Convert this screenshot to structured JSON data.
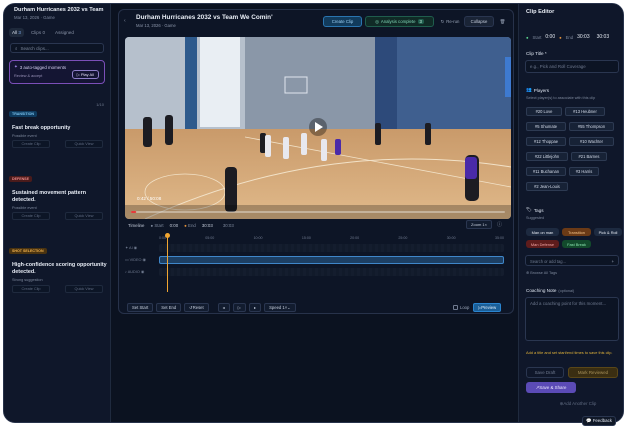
{
  "left": {
    "title": "Durham Hurricanes 2032 vs Team We Comin'",
    "subtitle_date": "Mar 13, 2026",
    "subtitle_type": "Game",
    "tabs": [
      "All",
      "Clips",
      "Assigned"
    ],
    "tab_counts": [
      "3",
      "0",
      ""
    ],
    "search_placeholder": "Search clips...",
    "auto_title": "3 auto-tagged moments",
    "auto_sub": "Review & accept",
    "play_all": "Play All",
    "moments": [
      {
        "badge": "TRANSITION",
        "badge_color": "#0e3a5e",
        "badge_text": "#7cc4f0",
        "num": "1/10",
        "title": "Fast break opportunity",
        "sub": "Possible event",
        "btn1": "Create Clip",
        "btn2": "Quick View"
      },
      {
        "badge": "DEFENSE",
        "badge_color": "#4a1b1b",
        "badge_text": "#f08a8a",
        "num": "",
        "title": "Sustained movement pattern detected.",
        "sub": "Possible event",
        "btn1": "Create Clip",
        "btn2": "Quick View"
      },
      {
        "badge": "SHOT SELECTION",
        "badge_color": "#4a3310",
        "badge_text": "#f2b24e",
        "num": "",
        "title": "High-confidence scoring opportunity detected.",
        "sub": "Strong suggestion",
        "btn1": "Create Clip",
        "btn2": "Quick View"
      }
    ]
  },
  "center": {
    "title": "Durham Hurricanes 2032 vs Team We Comin'",
    "date": "Mar 13, 2026",
    "type": "Game",
    "create_clip": "Create Clip",
    "analysis": "Analysis complete",
    "analysis_count": "3",
    "rerun": "Re-run",
    "collapse": "Collapse",
    "video_time": "0:42 / 50:08",
    "timeline_label": "Timeline",
    "start_label": "Start",
    "start_val": "0:00",
    "end_label": "End",
    "end_val": "30:03",
    "duration_val": "30:03",
    "zoom": "Zoom 1×",
    "ticks": [
      "0:00",
      "05:00",
      "10:00",
      "15:00",
      "20:00",
      "25:00",
      "30:00",
      "35:00"
    ],
    "track_labels": [
      "AI",
      "VIDEO",
      "AUDIO"
    ],
    "set_start": "Set Start",
    "set_end": "Set End",
    "reset": "Reset",
    "speed": "Speed 1×",
    "loop": "Loop",
    "preview": "Preview",
    "progress": 0.014
  },
  "right": {
    "header": "Clip Editor",
    "start_label": "Start",
    "start_val": "0:00",
    "end_label": "End",
    "end_val": "30:03",
    "duration_val": "30:03",
    "clip_title_label": "Clip Title *",
    "clip_title_placeholder": "e.g., Pick and Roll Coverage",
    "players_label": "Players",
    "players_hint": "Select player(s) to associate with this clip",
    "players": [
      "#20 Love",
      "#13 Heubner",
      "#5 Shumate",
      "#55 Thompson",
      "#12 Thoppae",
      "#10 Wachter",
      "#22 Littlejohn",
      "#21 Barnes",
      "#11 Buchanan",
      "#3 Harris",
      "#2 Jean-Louis"
    ],
    "tags_label": "Tags",
    "suggested_label": "Suggested",
    "tags": [
      {
        "label": "Man on man",
        "color": "#1d2a40"
      },
      {
        "label": "Transition",
        "color": "#6b3a16"
      },
      {
        "label": "Pick & Roll",
        "color": "#1d2a40"
      },
      {
        "label": "Man Defense",
        "color": "#5e1c1c"
      },
      {
        "label": "Fast Break",
        "color": "#124a2c"
      }
    ],
    "tag_placeholder": "Search or add tag...",
    "browse_tags": "Browse All Tags",
    "note_label": "Coaching Note",
    "note_optional": "(optional)",
    "note_placeholder": "Add a coaching point for this moment...",
    "warning": "Add a title and set start/end times to save this clip.",
    "save_draft": "Save Draft",
    "mark_reviewed": "Mark Reviewed",
    "save_share": "Save & Share",
    "add_another": "Add Another Clip",
    "accent": "#8b6cf0"
  },
  "feedback": "Feedback"
}
